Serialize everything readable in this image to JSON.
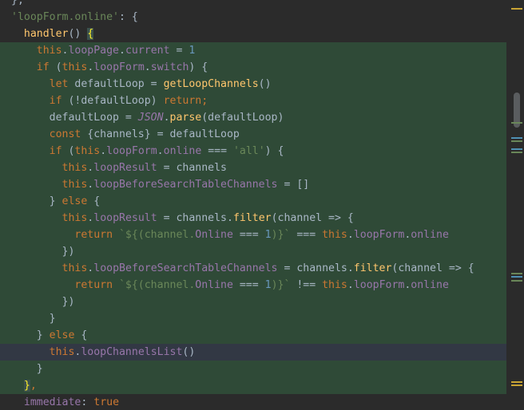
{
  "editor": {
    "language": "javascript",
    "theme_colors": {
      "background": "#2b2b2b",
      "highlight": "#2f4a37",
      "current_line": "#323844",
      "keyword": "#cc7832",
      "property": "#9876aa",
      "function": "#ffc66d",
      "string": "#6a8759",
      "number": "#6897bb"
    },
    "lines": [
      {
        "tokens": [
          {
            "t": "},",
            "c": ""
          }
        ]
      },
      {
        "tokens": [
          {
            "t": "'loopForm.online'",
            "c": "str"
          },
          {
            "t": ": {",
            "c": ""
          }
        ]
      },
      {
        "tokens": [
          {
            "t": "  ",
            "c": ""
          },
          {
            "t": "handler",
            "c": "fn"
          },
          {
            "t": "() ",
            "c": ""
          },
          {
            "t": "{",
            "c": "brace-match"
          }
        ]
      },
      {
        "tokens": [
          {
            "t": "    ",
            "c": ""
          },
          {
            "t": "this",
            "c": "kw"
          },
          {
            "t": ".",
            "c": ""
          },
          {
            "t": "loopPage",
            "c": "prop"
          },
          {
            "t": ".",
            "c": ""
          },
          {
            "t": "current",
            "c": "prop"
          },
          {
            "t": " = ",
            "c": ""
          },
          {
            "t": "1",
            "c": "num"
          }
        ]
      },
      {
        "tokens": [
          {
            "t": "    ",
            "c": ""
          },
          {
            "t": "if",
            "c": "kw"
          },
          {
            "t": " (",
            "c": ""
          },
          {
            "t": "this",
            "c": "kw"
          },
          {
            "t": ".",
            "c": ""
          },
          {
            "t": "loopForm",
            "c": "prop"
          },
          {
            "t": ".",
            "c": ""
          },
          {
            "t": "switch",
            "c": "prop"
          },
          {
            "t": ") {",
            "c": ""
          }
        ]
      },
      {
        "tokens": [
          {
            "t": "      ",
            "c": ""
          },
          {
            "t": "let",
            "c": "kw"
          },
          {
            "t": " defaultLoop = ",
            "c": ""
          },
          {
            "t": "getLoopChannels",
            "c": "fn"
          },
          {
            "t": "()",
            "c": ""
          }
        ]
      },
      {
        "tokens": [
          {
            "t": "      ",
            "c": ""
          },
          {
            "t": "if",
            "c": "kw"
          },
          {
            "t": " (!defaultLoop) ",
            "c": ""
          },
          {
            "t": "return",
            "c": "kw"
          },
          {
            "t": ";",
            "c": "kw"
          }
        ]
      },
      {
        "tokens": [
          {
            "t": "      defaultLoop = ",
            "c": ""
          },
          {
            "t": "JSON",
            "c": "ital"
          },
          {
            "t": ".",
            "c": ""
          },
          {
            "t": "parse",
            "c": "fn"
          },
          {
            "t": "(defaultLoop)",
            "c": ""
          }
        ]
      },
      {
        "tokens": [
          {
            "t": "      ",
            "c": ""
          },
          {
            "t": "const",
            "c": "kw"
          },
          {
            "t": " {channels} = defaultLoop",
            "c": ""
          }
        ]
      },
      {
        "tokens": [
          {
            "t": "      ",
            "c": ""
          },
          {
            "t": "if",
            "c": "kw"
          },
          {
            "t": " (",
            "c": ""
          },
          {
            "t": "this",
            "c": "kw"
          },
          {
            "t": ".",
            "c": ""
          },
          {
            "t": "loopForm",
            "c": "prop"
          },
          {
            "t": ".",
            "c": ""
          },
          {
            "t": "online",
            "c": "prop"
          },
          {
            "t": " === ",
            "c": ""
          },
          {
            "t": "'all'",
            "c": "str"
          },
          {
            "t": ") {",
            "c": ""
          }
        ]
      },
      {
        "tokens": [
          {
            "t": "        ",
            "c": ""
          },
          {
            "t": "this",
            "c": "kw"
          },
          {
            "t": ".",
            "c": ""
          },
          {
            "t": "loopResult",
            "c": "prop"
          },
          {
            "t": " = channels",
            "c": ""
          }
        ]
      },
      {
        "tokens": [
          {
            "t": "        ",
            "c": ""
          },
          {
            "t": "this",
            "c": "kw"
          },
          {
            "t": ".",
            "c": ""
          },
          {
            "t": "loopBeforeSearchTableChannels",
            "c": "prop"
          },
          {
            "t": " = []",
            "c": ""
          }
        ]
      },
      {
        "tokens": [
          {
            "t": "      } ",
            "c": ""
          },
          {
            "t": "else",
            "c": "kw"
          },
          {
            "t": " {",
            "c": ""
          }
        ]
      },
      {
        "tokens": [
          {
            "t": "        ",
            "c": ""
          },
          {
            "t": "this",
            "c": "kw"
          },
          {
            "t": ".",
            "c": ""
          },
          {
            "t": "loopResult",
            "c": "prop"
          },
          {
            "t": " = channels.",
            "c": ""
          },
          {
            "t": "filter",
            "c": "fn"
          },
          {
            "t": "(channel => {",
            "c": ""
          }
        ]
      },
      {
        "tokens": [
          {
            "t": "          ",
            "c": ""
          },
          {
            "t": "return",
            "c": "kw"
          },
          {
            "t": " `${(channel.",
            "c": "str"
          },
          {
            "t": "Online",
            "c": "prop"
          },
          {
            "t": " === ",
            "c": ""
          },
          {
            "t": "1",
            "c": "num"
          },
          {
            "t": ")}`",
            "c": "str"
          },
          {
            "t": " === ",
            "c": ""
          },
          {
            "t": "this",
            "c": "kw"
          },
          {
            "t": ".",
            "c": ""
          },
          {
            "t": "loopForm",
            "c": "prop"
          },
          {
            "t": ".",
            "c": ""
          },
          {
            "t": "online",
            "c": "prop"
          }
        ]
      },
      {
        "tokens": [
          {
            "t": "        })",
            "c": ""
          }
        ]
      },
      {
        "tokens": [
          {
            "t": "        ",
            "c": ""
          },
          {
            "t": "this",
            "c": "kw"
          },
          {
            "t": ".",
            "c": ""
          },
          {
            "t": "loopBeforeSearchTableChannels",
            "c": "prop"
          },
          {
            "t": " = channels.",
            "c": ""
          },
          {
            "t": "filter",
            "c": "fn"
          },
          {
            "t": "(channel => {",
            "c": ""
          }
        ]
      },
      {
        "tokens": [
          {
            "t": "          ",
            "c": ""
          },
          {
            "t": "return",
            "c": "kw"
          },
          {
            "t": " `${(channel.",
            "c": "str"
          },
          {
            "t": "Online",
            "c": "prop"
          },
          {
            "t": " === ",
            "c": ""
          },
          {
            "t": "1",
            "c": "num"
          },
          {
            "t": ")}`",
            "c": "str"
          },
          {
            "t": " !== ",
            "c": ""
          },
          {
            "t": "this",
            "c": "kw"
          },
          {
            "t": ".",
            "c": ""
          },
          {
            "t": "loopForm",
            "c": "prop"
          },
          {
            "t": ".",
            "c": ""
          },
          {
            "t": "online",
            "c": "prop"
          }
        ]
      },
      {
        "tokens": [
          {
            "t": "        })",
            "c": ""
          }
        ]
      },
      {
        "tokens": [
          {
            "t": "      }",
            "c": ""
          }
        ]
      },
      {
        "tokens": [
          {
            "t": "    } ",
            "c": ""
          },
          {
            "t": "else",
            "c": "kw"
          },
          {
            "t": " {",
            "c": ""
          }
        ]
      },
      {
        "tokens": [
          {
            "t": "      ",
            "c": ""
          },
          {
            "t": "this",
            "c": "kw"
          },
          {
            "t": ".",
            "c": ""
          },
          {
            "t": "loopChannelsList",
            "c": "prop"
          },
          {
            "t": "()",
            "c": ""
          }
        ]
      },
      {
        "tokens": [
          {
            "t": "    }",
            "c": ""
          }
        ]
      },
      {
        "tokens": [
          {
            "t": "  ",
            "c": ""
          },
          {
            "t": "}",
            "c": "brace-match"
          },
          {
            "t": ",",
            "c": "kw"
          }
        ]
      },
      {
        "tokens": [
          {
            "t": "  ",
            "c": ""
          },
          {
            "t": "immediate",
            "c": "prop"
          },
          {
            "t": ": ",
            "c": ""
          },
          {
            "t": "true",
            "c": "kw"
          }
        ]
      }
    ],
    "highlighted_line_indices": [
      3,
      4,
      5,
      6,
      7,
      8,
      9,
      10,
      11,
      12,
      13,
      14,
      15,
      16,
      17,
      18,
      19,
      20,
      22,
      23
    ],
    "current_line_index": 21
  },
  "scrollbar": {
    "markers": [
      {
        "color": "#c9a434"
      },
      {
        "color": "#6a8759"
      },
      {
        "color": "#4e8fb3"
      },
      {
        "color": "#6a8759"
      },
      {
        "color": "#4e8fb3"
      },
      {
        "color": "#6a8759"
      },
      {
        "color": "#6a8759"
      },
      {
        "color": "#4e8fb3"
      },
      {
        "color": "#6a8759"
      },
      {
        "color": "#c9a434"
      },
      {
        "color": "#c9a434"
      }
    ]
  }
}
